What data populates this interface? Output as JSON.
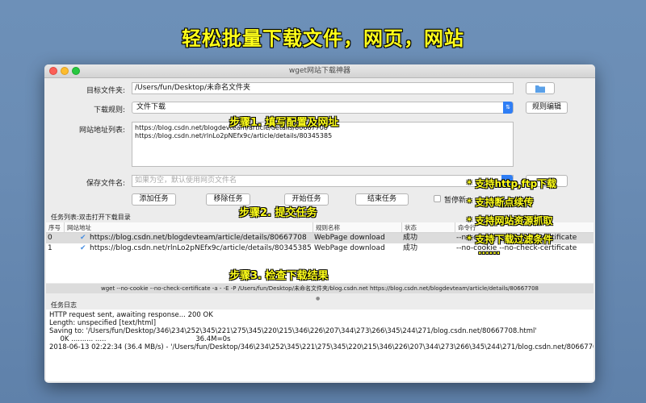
{
  "banner": "轻松批量下载文件，网页，网站",
  "window": {
    "title": "wget网站下载神器"
  },
  "form": {
    "target_folder_label": "目标文件夹:",
    "target_folder_value": "/Users/fun/Desktop/未命名文件夹",
    "rule_label": "下载规则:",
    "rule_value": "文件下载",
    "rule_edit_button": "规则编辑",
    "url_list_label": "网站地址列表:",
    "url_list_lines": [
      "https://blog.csdn.net/blogdevteam/article/details/80667708",
      "https://blog.csdn.net/rlnLo2pNEfx9c/article/details/80345385"
    ],
    "save_name_label": "保存文件名:",
    "save_name_placeholder": "如果为空，默认使用网页文件名"
  },
  "buttons": {
    "add": "添加任务",
    "remove": "移除任务",
    "start": "开始任务",
    "stop": "结束任务",
    "pause_label": "暂停新"
  },
  "task_list": {
    "label": "任务列表:双击打开下载目录",
    "columns": [
      "序号",
      "网站地址",
      "规则名称",
      "状态",
      "命令行"
    ],
    "rows": [
      {
        "index": "0",
        "url": "https://blog.csdn.net/blogdevteam/article/details/80667708",
        "rule": "WebPage download",
        "status": "成功",
        "cmd": "--no-cookie --no-check-certificate"
      },
      {
        "index": "1",
        "url": "https://blog.csdn.net/rlnLo2pNEfx9c/article/details/80345385",
        "rule": "WebPage download",
        "status": "成功",
        "cmd": "--no-cookie --no-check-certificate"
      }
    ]
  },
  "command_line": "wget --no-cookie --no-check-certificate -a - -E -P /Users/fun/Desktop/未命名文件夹/blog.csdn.net https://blog.csdn.net/blogdevteam/article/details/80667708",
  "log": {
    "label": "任务日志",
    "lines": [
      "HTTP request sent, awaiting response... 200 OK",
      "Length: unspecified [text/html]",
      "Saving to: '/Users/fun/Desktop/346\\234\\252\\345\\221\\275\\345\\220\\215\\346\\226\\207\\344\\273\\266\\345\\244\\271/blog.csdn.net/80667708.html'",
      "",
      "     0K .......... .....                                         36.4M=0s",
      "",
      "2018-06-13 02:22:34 (36.4 MB/s) - '/Users/fun/Desktop/346\\234\\252\\345\\221\\275\\345\\220\\215\\346\\226\\207\\344\\273\\266\\345\\244\\271/blog.csdn.net/80667708.html' saved [101151]"
    ]
  },
  "annotations": {
    "step1": "步骤1. 填写配置及网址",
    "step2": "步骤2. 提交任务",
    "step3": "步骤3. 检查下载结果",
    "feature1": "* 支持http,ftp下载",
    "feature2": "* 支持断点续传",
    "feature3": "* 支持网站资源抓取",
    "feature4": "* 支持下载过滤条件",
    "more": "......"
  },
  "colors": {
    "banner": "#ffff1a",
    "accent": "#2f7ef5",
    "folder_icon": "#5aa0e8"
  }
}
